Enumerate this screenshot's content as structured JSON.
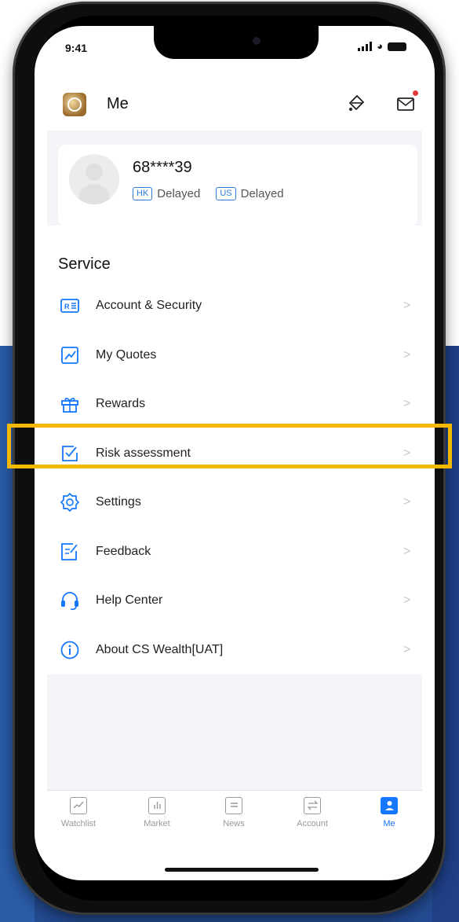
{
  "status_bar": {
    "time": "9:41"
  },
  "header": {
    "title": "Me"
  },
  "profile": {
    "account_id": "68****39",
    "markets": [
      {
        "tag": "HK",
        "status": "Delayed"
      },
      {
        "tag": "US",
        "status": "Delayed"
      }
    ]
  },
  "section_title": "Service",
  "menu": [
    {
      "label": "Account & Security",
      "icon": "id-card-icon"
    },
    {
      "label": "My Quotes",
      "icon": "chart-line-icon"
    },
    {
      "label": "Rewards",
      "icon": "gift-icon"
    },
    {
      "label": "Risk assessment",
      "icon": "checkbox-icon"
    },
    {
      "label": "Settings",
      "icon": "gear-icon"
    },
    {
      "label": "Feedback",
      "icon": "edit-note-icon"
    },
    {
      "label": "Help Center",
      "icon": "headset-icon"
    },
    {
      "label": "About CS Wealth[UAT]",
      "icon": "info-icon"
    }
  ],
  "chevron": ">",
  "tabbar": [
    {
      "label": "Watchlist",
      "active": false
    },
    {
      "label": "Market",
      "active": false
    },
    {
      "label": "News",
      "active": false
    },
    {
      "label": "Account",
      "active": false
    },
    {
      "label": "Me",
      "active": true
    }
  ],
  "colors": {
    "accent": "#1677ff",
    "highlight": "#f5b800",
    "notification": "#e53935"
  }
}
